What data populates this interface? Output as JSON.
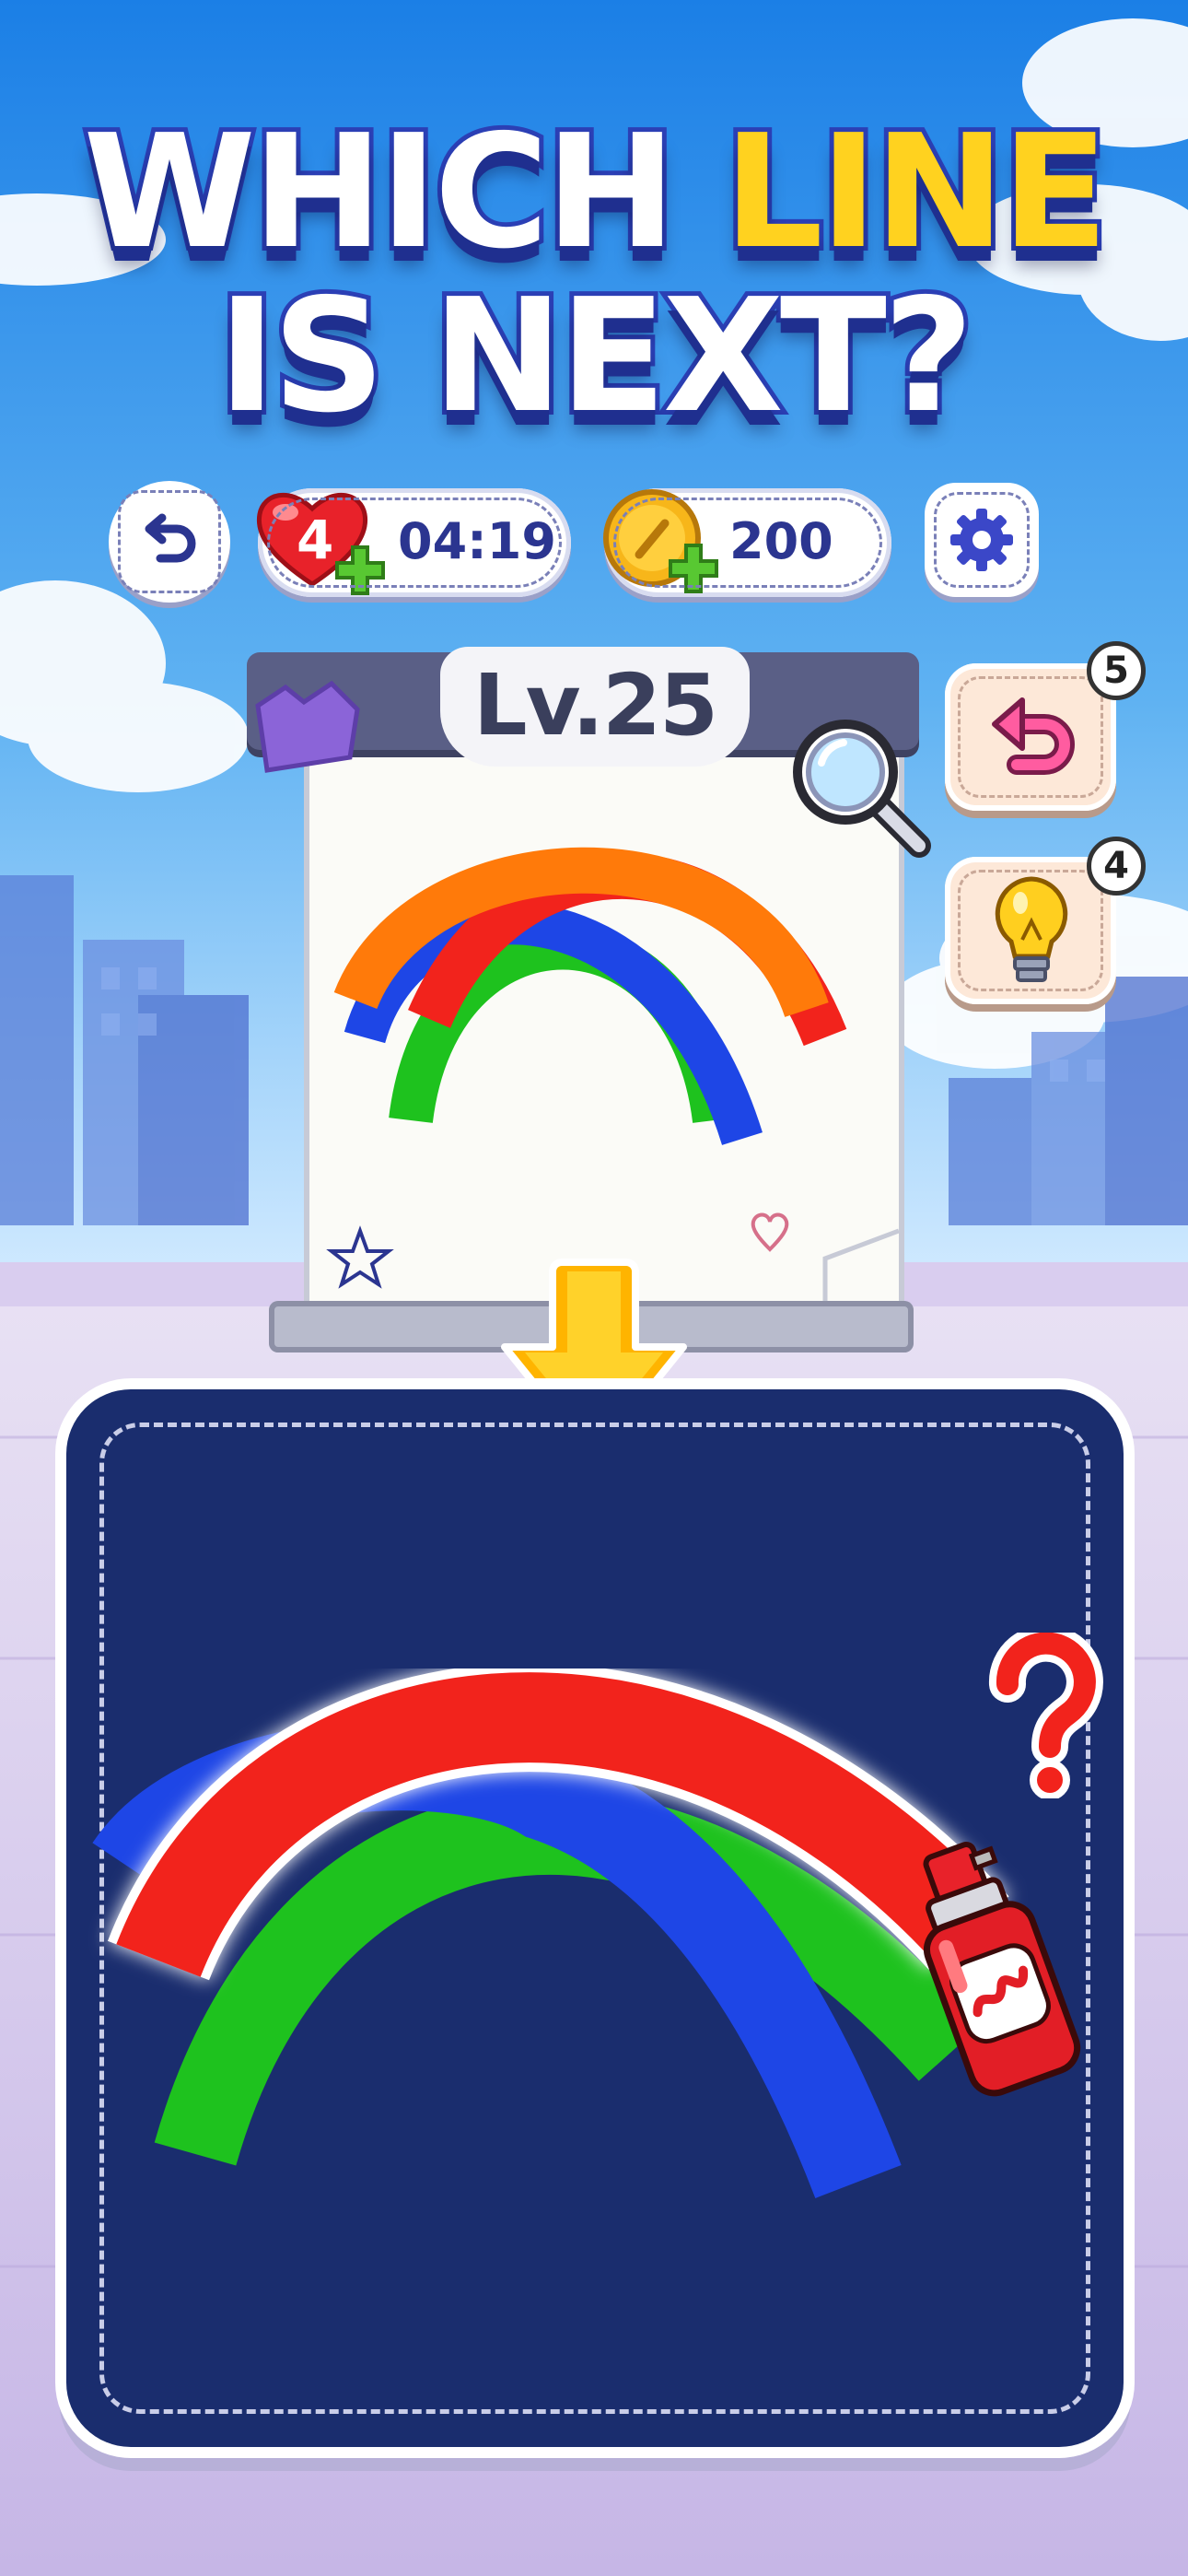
{
  "title": {
    "line1_part1": "WHICH ",
    "line1_highlight": "LINE",
    "line2": "IS NEXT?"
  },
  "top_bar": {
    "lives": "4",
    "timer": "04:19",
    "coins": "200"
  },
  "level": {
    "label": "Lv.25"
  },
  "side_buttons": {
    "undo_count": "5",
    "hint_count": "4"
  },
  "board": {
    "question_mark": "?"
  },
  "colors": {
    "sky_top": "#1f86e8",
    "sky_bottom": "#bfe3ff",
    "board": "#1a2d6e",
    "red_line": "#f2231c",
    "green_line": "#1ec21e",
    "blue_line": "#1e46e6",
    "orange_line": "#ff7a0a",
    "title_accent": "#ffd21f"
  },
  "icons": [
    "back-icon",
    "heart-icon",
    "plus-icon",
    "coin-icon",
    "gear-icon",
    "magnifier-icon",
    "undo-icon",
    "lightbulb-icon",
    "down-arrow-icon",
    "spray-can-icon",
    "star-icon",
    "heart-doodle-icon"
  ]
}
